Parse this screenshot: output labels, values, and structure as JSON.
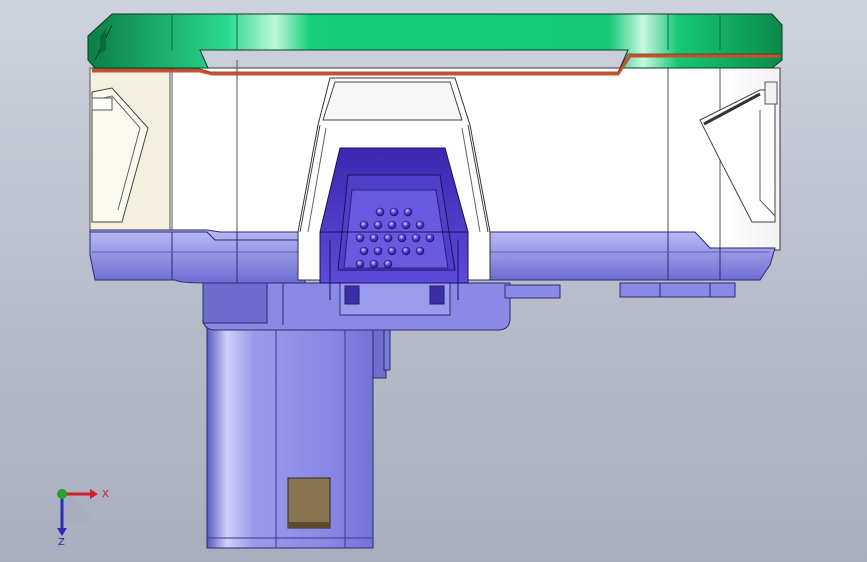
{
  "view": {
    "background_top": "#ced2dc",
    "background_bottom": "#a9aebe"
  },
  "model": {
    "parts": [
      {
        "name": "top-cover",
        "color": "#13c46e"
      },
      {
        "name": "housing-body",
        "color": "#ffffff"
      },
      {
        "name": "side-grip-left",
        "color": "#f3f1dd"
      },
      {
        "name": "base-plate",
        "color": "#8585e0"
      },
      {
        "name": "connector-socket",
        "color": "#4a34c4"
      },
      {
        "name": "handle-column",
        "color": "#8a8ae6"
      },
      {
        "name": "label-pad",
        "color": "#8a7450"
      },
      {
        "name": "seal-line",
        "color": "#c8502a"
      }
    ],
    "socket_pins": 22
  },
  "triad": {
    "x_label": "X",
    "z_label": "Z",
    "x_color": "#d41f2e",
    "y_color": "#1fa32a",
    "z_color": "#2b2bb8"
  }
}
